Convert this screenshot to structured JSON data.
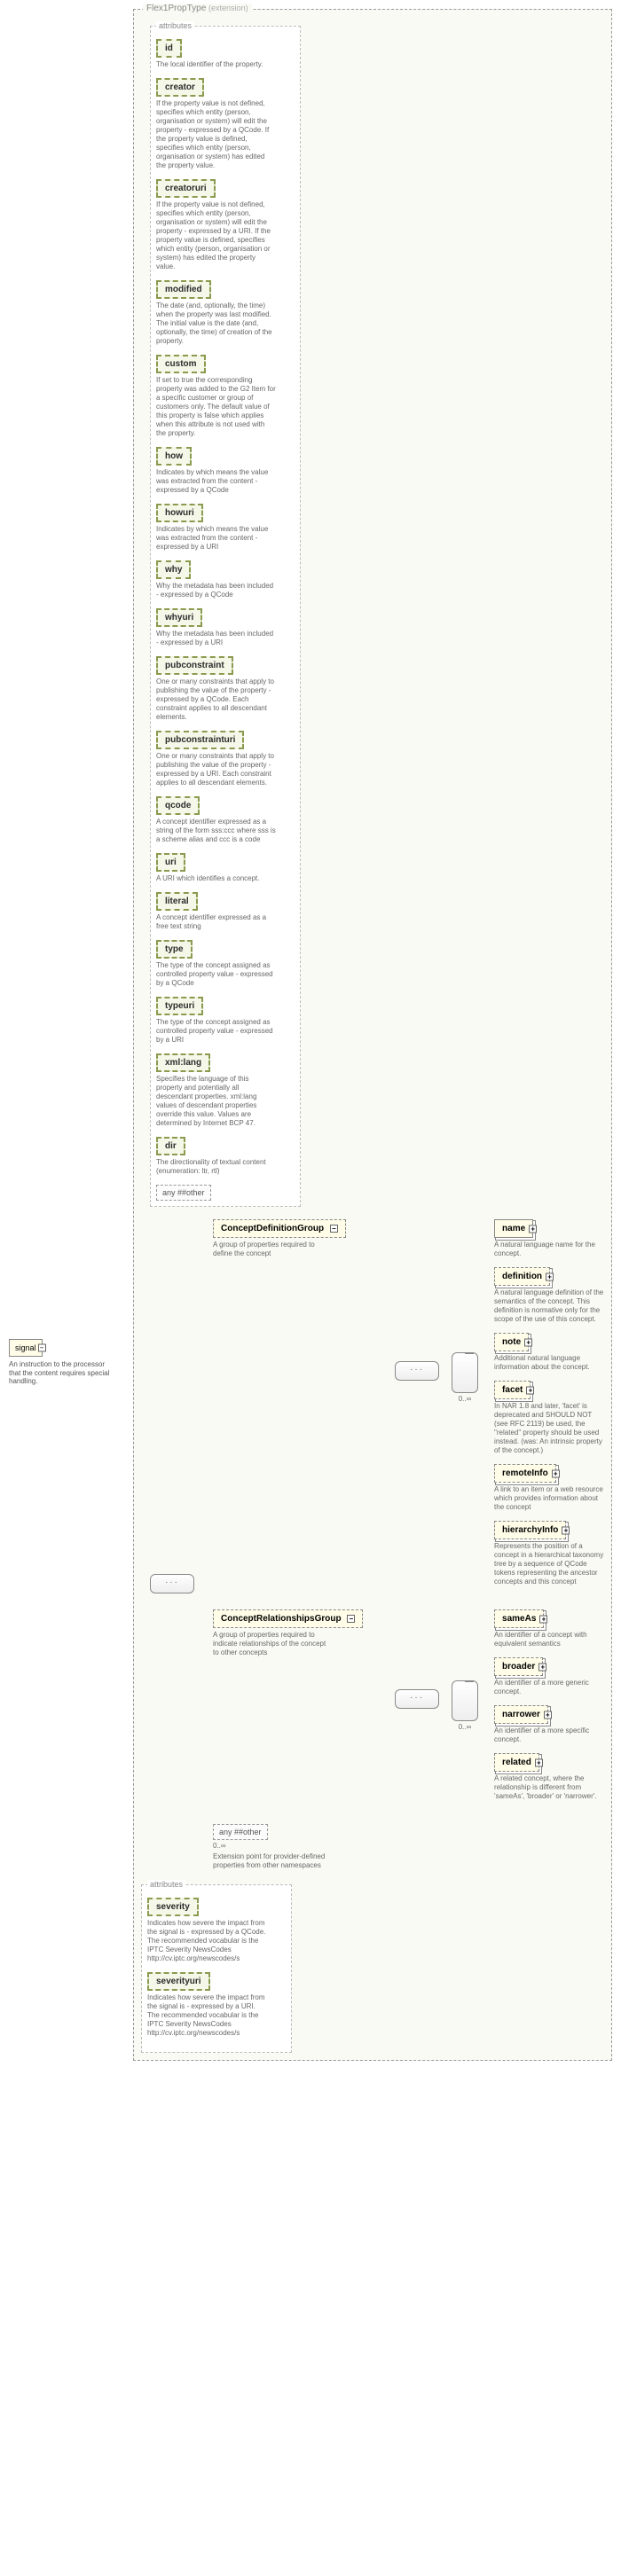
{
  "root": {
    "name": "signal",
    "desc": "An instruction to the processor that the content requires special handling."
  },
  "extension": {
    "typeName": "Flex1PropType",
    "suffix": "(extension)"
  },
  "attributes_label": "attributes",
  "attributes": [
    {
      "name": "id",
      "desc": "The local identifier of the property."
    },
    {
      "name": "creator",
      "desc": "If the property value is not defined, specifies which entity (person, organisation or system) will edit the property - expressed by a QCode. If the property value is defined, specifies which entity (person, organisation or system) has edited the property value."
    },
    {
      "name": "creatoruri",
      "desc": "If the property value is not defined, specifies which entity (person, organisation or system) will edit the property - expressed by a URI. If the property value is defined, specifies which entity (person, organisation or system) has edited the property value."
    },
    {
      "name": "modified",
      "desc": "The date (and, optionally, the time) when the property was last modified. The initial value is the date (and, optionally, the time) of creation of the property."
    },
    {
      "name": "custom",
      "desc": "If set to true the corresponding property was added to the G2 Item for a specific customer or group of customers only. The default value of this property is false which applies when this attribute is not used with the property."
    },
    {
      "name": "how",
      "desc": "Indicates by which means the value was extracted from the content - expressed by a QCode"
    },
    {
      "name": "howuri",
      "desc": "Indicates by which means the value was extracted from the content - expressed by a URI"
    },
    {
      "name": "why",
      "desc": "Why the metadata has been included - expressed by a QCode"
    },
    {
      "name": "whyuri",
      "desc": "Why the metadata has been included - expressed by a URI"
    },
    {
      "name": "pubconstraint",
      "desc": "One or many constraints that apply to publishing the value of the property - expressed by a QCode. Each constraint applies to all descendant elements."
    },
    {
      "name": "pubconstrainturi",
      "desc": "One or many constraints that apply to publishing the value of the property - expressed by a URI. Each constraint applies to all descendant elements."
    },
    {
      "name": "qcode",
      "desc": "A concept identifier expressed as a string of the form sss:ccc where sss is a scheme alias and ccc is a code"
    },
    {
      "name": "uri",
      "desc": "A URI which identifies a concept."
    },
    {
      "name": "literal",
      "desc": "A concept identifier expressed as a free text string"
    },
    {
      "name": "type",
      "desc": "The type of the concept assigned as controlled property value - expressed by a QCode"
    },
    {
      "name": "typeuri",
      "desc": "The type of the concept assigned as controlled property value - expressed by a URI"
    },
    {
      "name": "xml:lang",
      "desc": "Specifies the language of this property and potentially all descendant properties. xml:lang values of descendant properties override this value. Values are determined by Internet BCP 47."
    },
    {
      "name": "dir",
      "desc": "The directionality of textual content (enumeration: ltr, rtl)"
    }
  ],
  "any_other": "##other",
  "groups": {
    "def": {
      "name": "ConceptDefinitionGroup",
      "card": "0..∞",
      "desc": "A group of properties required to define the concept",
      "items": [
        {
          "name": "name",
          "dashed": false,
          "stack": true,
          "desc": "A natural language name for the concept."
        },
        {
          "name": "definition",
          "dashed": true,
          "stack": true,
          "desc": "A natural language definition of the semantics of the concept. This definition is normative only for the scope of the use of this concept."
        },
        {
          "name": "note",
          "dashed": true,
          "stack": true,
          "desc": "Additional natural language information about the concept."
        },
        {
          "name": "facet",
          "dashed": true,
          "stack": true,
          "desc": "In NAR 1.8 and later, 'facet' is deprecated and SHOULD NOT (see RFC 2119) be used, the \"related\" property should be used instead. (was: An intrinsic property of the concept.)"
        },
        {
          "name": "remoteInfo",
          "dashed": true,
          "stack": true,
          "desc": "A link to an item or a web resource which provides information about the concept"
        },
        {
          "name": "hierarchyInfo",
          "dashed": true,
          "stack": true,
          "desc": "Represents the position of a concept in a hierarchical taxonomy tree by a sequence of QCode tokens representing the ancestor concepts and this concept"
        }
      ]
    },
    "rel": {
      "name": "ConceptRelationshipsGroup",
      "card": "0..∞",
      "desc": "A group of properties required to indicate relationships of the concept to other concepts",
      "items": [
        {
          "name": "sameAs",
          "dashed": true,
          "stack": true,
          "desc": "An identifier of a concept with equivalent semantics"
        },
        {
          "name": "broader",
          "dashed": true,
          "stack": true,
          "desc": "An identifier of a more generic concept."
        },
        {
          "name": "narrower",
          "dashed": true,
          "stack": true,
          "desc": "An identifier of a more specific concept."
        },
        {
          "name": "related",
          "dashed": true,
          "stack": true,
          "desc": "A related concept, where the relationship is different from 'sameAs', 'broader' or 'narrower'."
        }
      ]
    }
  },
  "ext_any": {
    "label": "##other",
    "card": "0..∞",
    "desc": "Extension point for provider-defined properties from other namespaces"
  },
  "attributes2": [
    {
      "name": "severity",
      "desc": "Indicates how severe the impact from the signal is - expressed by a QCode. The recommended vocabular is the IPTC Severity NewsCodes http://cv.iptc.org/newscodes/s"
    },
    {
      "name": "severityuri",
      "desc": "Indicates how severe the impact from the signal is - expressed by a URI. The recommended vocabular is the IPTC Severity NewsCodes http://cv.iptc.org/newscodes/s"
    }
  ]
}
